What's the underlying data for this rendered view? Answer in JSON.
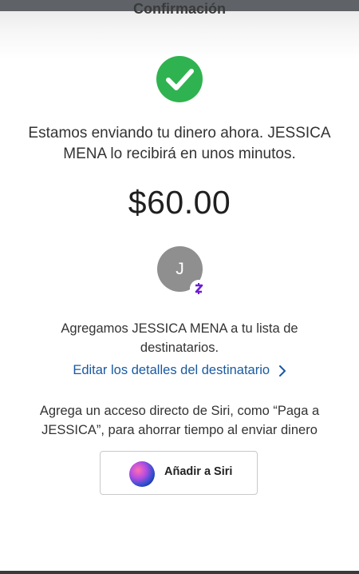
{
  "header": {
    "title": "Confirmación"
  },
  "confirmation": {
    "message": "Estamos enviando tu dinero ahora. JESSICA MENA lo recibirá en unos minutos.",
    "amount": "$60.00"
  },
  "recipient": {
    "avatar_initial": "J",
    "added_text": "Agregamos JESSICA MENA a tu lista de destinatarios.",
    "edit_link": "Editar los detalles del destinatario"
  },
  "siri": {
    "prompt": "Agrega un acceso directo de Siri, como “Paga a JESSICA”, para ahorrar tiempo al enviar dinero",
    "button_label": "Añadir a Siri"
  },
  "colors": {
    "success_green": "#2fb350",
    "link_blue": "#1a5aa0",
    "zelle_purple": "#6d1ed4"
  },
  "icons": {
    "success": "checkmark-circle-icon",
    "zelle": "zelle-icon",
    "chevron": "chevron-right-icon",
    "siri": "siri-icon"
  }
}
